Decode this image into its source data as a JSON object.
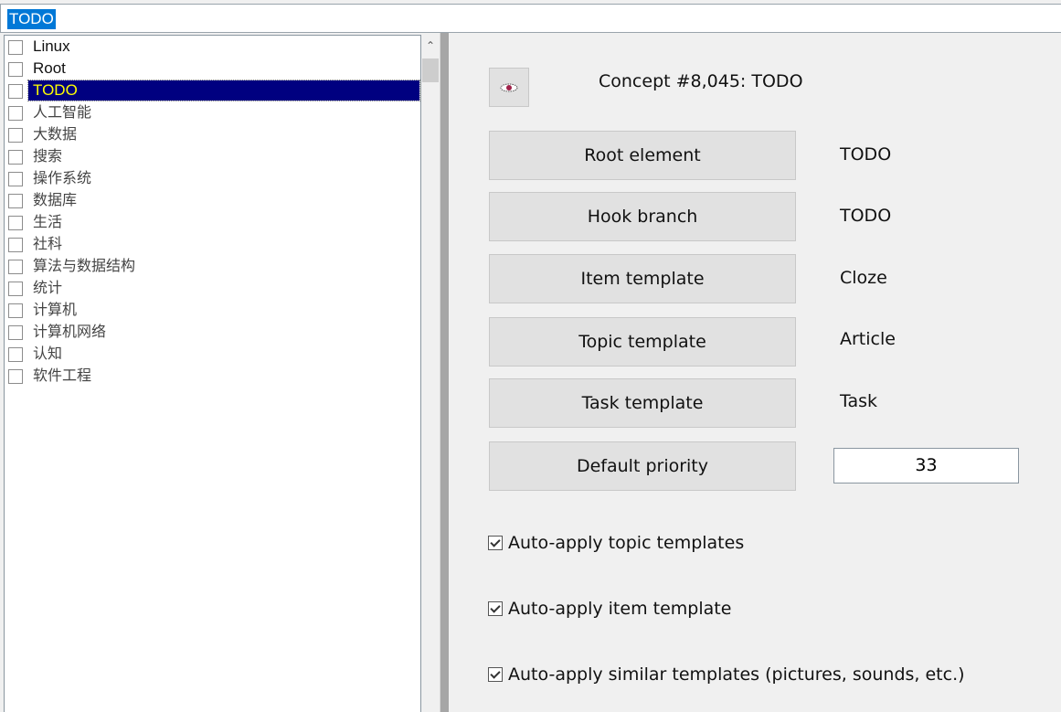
{
  "search": {
    "value": "TODO"
  },
  "tree": {
    "items": [
      {
        "label": "Linux",
        "checked": false
      },
      {
        "label": "Root",
        "checked": false
      },
      {
        "label": "TODO",
        "checked": false,
        "selected": true
      },
      {
        "label": "人工智能",
        "checked": false
      },
      {
        "label": "大数据",
        "checked": false
      },
      {
        "label": "搜索",
        "checked": false
      },
      {
        "label": "操作系统",
        "checked": false
      },
      {
        "label": "数据库",
        "checked": false
      },
      {
        "label": "生活",
        "checked": false
      },
      {
        "label": "社科",
        "checked": false
      },
      {
        "label": "算法与数据结构",
        "checked": false
      },
      {
        "label": "统计",
        "checked": false
      },
      {
        "label": "计算机",
        "checked": false
      },
      {
        "label": "计算机网络",
        "checked": false
      },
      {
        "label": "认知",
        "checked": false
      },
      {
        "label": "软件工程",
        "checked": false
      }
    ]
  },
  "panel": {
    "title": "Concept #8,045: TODO",
    "fields": [
      {
        "button": "Root element",
        "value": "TODO"
      },
      {
        "button": "Hook branch",
        "value": "TODO"
      },
      {
        "button": "Item template",
        "value": "Cloze"
      },
      {
        "button": "Topic template",
        "value": "Article"
      },
      {
        "button": "Task template",
        "value": "Task"
      }
    ],
    "priority": {
      "button": "Default priority",
      "value": "33"
    },
    "checkboxes": [
      {
        "label": "Auto-apply topic templates",
        "checked": true
      },
      {
        "label": "Auto-apply item template",
        "checked": true
      },
      {
        "label": "Auto-apply similar templates (pictures, sounds, etc.)",
        "checked": true
      }
    ]
  }
}
